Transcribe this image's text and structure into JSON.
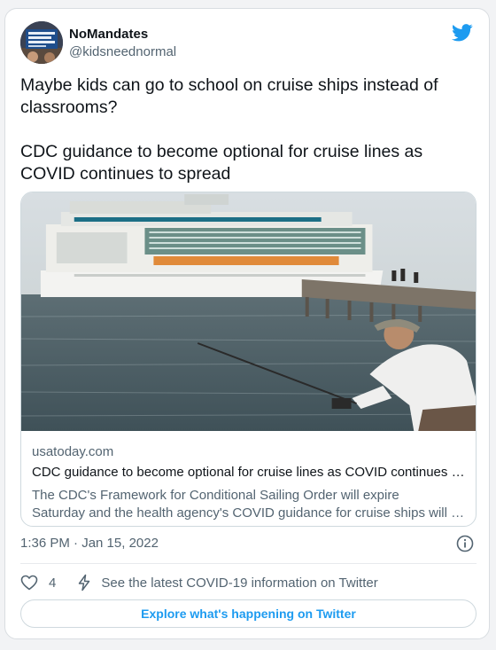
{
  "colors": {
    "accent": "#1d9bf0",
    "text_primary": "#0f1419",
    "text_secondary": "#536471",
    "border": "#cfd9de"
  },
  "author": {
    "display_name": "NoMandates",
    "handle": "@kidsneednormal",
    "avatar_icon": "protest-sign-avatar"
  },
  "header": {
    "brand_icon": "twitter-bird-icon"
  },
  "tweet": {
    "text_line_1": "Maybe kids can go to school on cruise ships instead of classrooms?",
    "text_line_2": "CDC guidance to become optional for cruise lines as COVID continues to spread"
  },
  "link_card": {
    "image_description_icon": "cruise-ship-photo",
    "domain": "usatoday.com",
    "title": "CDC guidance to become optional for cruise lines as COVID continues to spread",
    "description_line_1": "The CDC's Framework for Conditional Sailing Order will expire",
    "description_line_2": "Saturday and the health agency's COVID guidance for cruise ships will become optional."
  },
  "meta": {
    "timestamp": "1:36 PM · Jan 15, 2022",
    "info_icon": "info-icon"
  },
  "actions": {
    "like_icon": "heart-icon",
    "like_count": "4",
    "covid_icon": "bolt-icon",
    "covid_info_label": "See the latest COVID-19 information on Twitter"
  },
  "footer": {
    "explore_label": "Explore what's happening on Twitter"
  }
}
